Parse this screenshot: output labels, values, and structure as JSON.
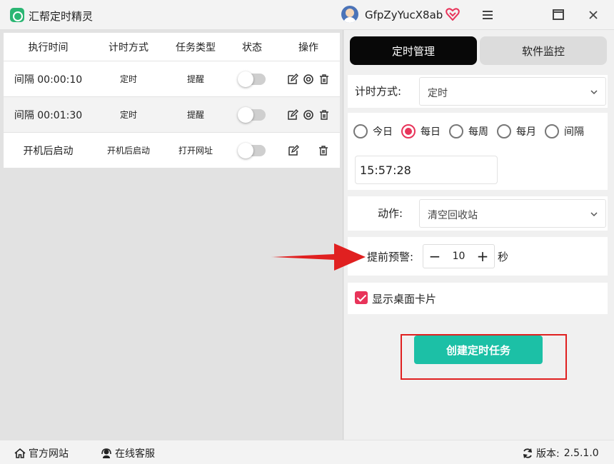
{
  "app": {
    "title": "汇帮定时精灵",
    "username": "GfpZyYucX8ab"
  },
  "colors": {
    "accent": "#e8345a",
    "create_button": "#1cc0a6",
    "active_tab": "#080808",
    "highlight": "#e02020",
    "logo": "#2bb673"
  },
  "icons": {
    "logo": "alarm-clock-icon",
    "vip": "vip-heart-icon",
    "menu": "hamburger-icon",
    "maximize": "maximize-icon",
    "close": "close-icon",
    "edit": "edit-icon",
    "target": "target-icon",
    "delete": "trash-icon",
    "home": "home-icon",
    "support": "headset-icon",
    "refresh": "refresh-icon"
  },
  "task_table": {
    "headers": [
      "执行时间",
      "计时方式",
      "任务类型",
      "状态",
      "操作"
    ],
    "rows": [
      {
        "time": "间隔 00:00:10",
        "mode": "定时",
        "type": "提醒",
        "enabled": false
      },
      {
        "time": "间隔 00:01:30",
        "mode": "定时",
        "type": "提醒",
        "enabled": false
      },
      {
        "time": "开机后启动",
        "mode": "开机后启动",
        "type": "打开网址",
        "enabled": false
      }
    ]
  },
  "tabs": {
    "active": "定时管理",
    "inactive": "软件监控"
  },
  "form": {
    "mode_label": "计时方式:",
    "mode_value": "定时",
    "repeat_options": [
      "今日",
      "每日",
      "每周",
      "每月",
      "间隔"
    ],
    "repeat_selected": "每日",
    "time_value": "15:57:28",
    "action_label": "动作:",
    "action_value": "清空回收站",
    "warning_label": "提前预警:",
    "warning_value": "10",
    "warning_unit": "秒",
    "desktop_card_label": "显示桌面卡片",
    "desktop_card_checked": true,
    "create_button": "创建定时任务"
  },
  "footer": {
    "website": "官方网站",
    "support": "在线客服",
    "version_label": "版本:",
    "version": "2.5.1.0"
  }
}
